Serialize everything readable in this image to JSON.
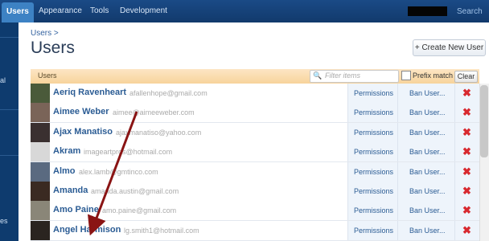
{
  "nav": {
    "tabs": [
      {
        "label": "Users"
      },
      {
        "label": "Appearance"
      },
      {
        "label": "Tools"
      },
      {
        "label": "Development"
      }
    ],
    "search_label": "Search"
  },
  "sidebar": {
    "fragments": [
      "al",
      "es"
    ]
  },
  "page": {
    "breadcrumb": "Users >",
    "title": "Users",
    "create_button": "+ Create New User"
  },
  "list": {
    "header_label": "Users",
    "filter_placeholder": "Filter items",
    "prefix_label": "Prefix match",
    "clear_label": "Clear",
    "permissions_label": "Permissions",
    "ban_label": "Ban User...",
    "delete_glyph": "✖",
    "users": [
      {
        "name": "Aeriq Ravenheart",
        "email": "afallenhope@gmail.com",
        "avatar_color": "#4a5a3a"
      },
      {
        "name": "Aimee Weber",
        "email": "aimee@aimeeweber.com",
        "avatar_color": "#7a6458"
      },
      {
        "name": "Ajax Manatiso",
        "email": "ajaxmanatiso@yahoo.com",
        "avatar_color": "#3a3030"
      },
      {
        "name": "Akram",
        "email": "imageartpros@hotmail.com",
        "avatar_color": "#d8d8d8"
      },
      {
        "name": "Almo",
        "email": "alex.lamb@gmtinco.com",
        "avatar_color": "#5a6a80"
      },
      {
        "name": "Amanda",
        "email": "amanda.austin@gmail.com",
        "avatar_color": "#3a2a22"
      },
      {
        "name": "Amo Paine",
        "email": "amo.paine@gmail.com",
        "avatar_color": "#8a8678"
      },
      {
        "name": "Angel Harmison",
        "email": "lg.smith1@hotmail.com",
        "avatar_color": "#2a2420"
      }
    ]
  },
  "colors": {
    "topbar": "#163f74",
    "active_tab": "#3d82c4",
    "header_band": "#f9d9a6",
    "link": "#2b5c94",
    "arrow": "#8a1414",
    "delete": "#d8292f"
  }
}
